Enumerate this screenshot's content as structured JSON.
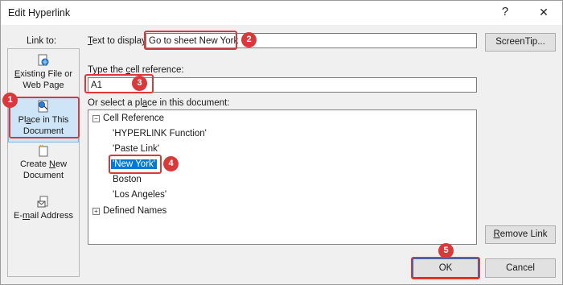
{
  "window": {
    "title": "Edit Hyperlink",
    "help_glyph": "?",
    "close_glyph": "✕"
  },
  "link_to": {
    "label": "Link to:",
    "items": [
      {
        "line1_pre": "",
        "line1_key": "E",
        "line1_post": "xisting File or",
        "line2": "Web Page",
        "icon": "web-page-icon"
      },
      {
        "line1_pre": "Pl",
        "line1_key": "a",
        "line1_post": "ce in This",
        "line2": "Document",
        "icon": "place-in-document-icon",
        "selected": true
      },
      {
        "line1_pre": "Create ",
        "line1_key": "N",
        "line1_post": "ew",
        "line2": "Document",
        "icon": "new-document-icon"
      },
      {
        "line1_pre": "E-",
        "line1_key": "m",
        "line1_post": "ail Address",
        "line2": "",
        "icon": "email-icon"
      }
    ]
  },
  "text_to_display": {
    "label_key": "T",
    "label_rest": "ext to display:",
    "value": "Go to sheet New York"
  },
  "screentip_button": {
    "label": "ScreenTip..."
  },
  "cell_reference": {
    "label_pre": "Type the ",
    "label_key": "c",
    "label_post": "ell reference:",
    "value": "A1"
  },
  "place_list": {
    "label_pre": "Or select a pl",
    "label_key": "a",
    "label_post": "ce in this document:",
    "groups": [
      {
        "name": "Cell Reference",
        "expander": "−",
        "children": [
          "'HYPERLINK Function'",
          "'Paste Link'",
          "'New York'",
          "Boston",
          "'Los Angeles'"
        ],
        "selected": "'New York'"
      },
      {
        "name": "Defined Names",
        "expander": "+"
      }
    ]
  },
  "remove_link_button": {
    "label_key": "R",
    "label_rest": "emove Link"
  },
  "ok_button": {
    "label": "OK"
  },
  "cancel_button": {
    "label": "Cancel"
  },
  "annotations": {
    "badges": [
      "1",
      "2",
      "3",
      "4",
      "5"
    ],
    "color": "#d9393a"
  },
  "colors": {
    "selection": "#0078d7",
    "accent_highlight": "#cde5f7"
  }
}
